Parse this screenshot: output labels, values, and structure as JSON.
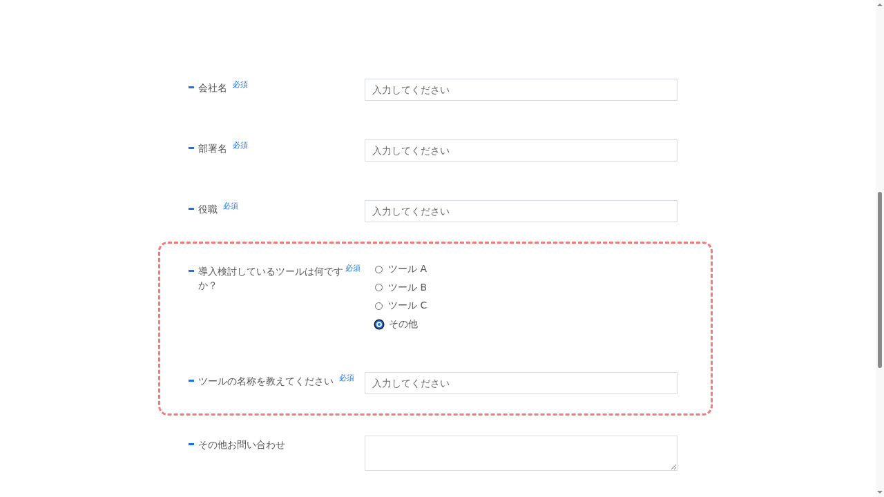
{
  "groups": [
    {
      "highlighted": false,
      "fields": [
        {
          "kind": "text",
          "label": "会社名",
          "badge": "必須",
          "placeholder": "入力してください"
        },
        {
          "kind": "text",
          "label": "部署名",
          "badge": "必須",
          "placeholder": "入力してください"
        },
        {
          "kind": "text",
          "label": "役職",
          "badge": "必須",
          "placeholder": "入力してください"
        }
      ]
    },
    {
      "highlighted": true,
      "fields": [
        {
          "kind": "radio",
          "label": "導入検討しているツールは何ですか？",
          "badge": "必須",
          "options": [
            {
              "label": "ツール A",
              "selected": false
            },
            {
              "label": "ツール B",
              "selected": false
            },
            {
              "label": "ツール C",
              "selected": false
            },
            {
              "label": "その他",
              "selected": true
            }
          ]
        },
        {
          "kind": "text",
          "label": "ツールの名称を教えてください",
          "badge": "必須",
          "placeholder": "入力してください"
        }
      ]
    },
    {
      "highlighted": false,
      "fields": [
        {
          "kind": "textarea",
          "label": "その他お問い合わせ"
        }
      ]
    }
  ]
}
